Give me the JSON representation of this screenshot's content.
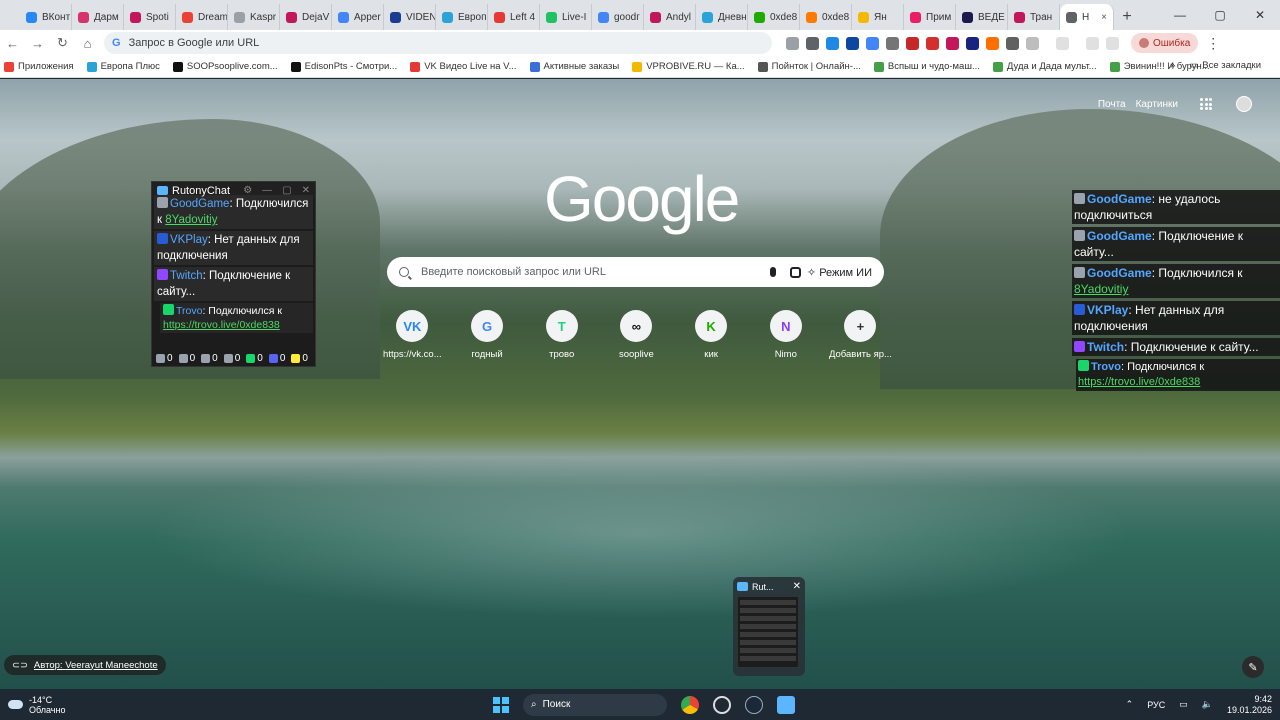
{
  "tabs": [
    {
      "label": "ВКонт",
      "color": "#2787f5"
    },
    {
      "label": "Дарм",
      "color": "#d6336c"
    },
    {
      "label": "Spoti",
      "color": "#c2185b"
    },
    {
      "label": "Dream",
      "color": "#ea4335"
    },
    {
      "label": "Kaspr",
      "color": "#9aa0a6"
    },
    {
      "label": "DejaV",
      "color": "#c2185b"
    },
    {
      "label": "Apper",
      "color": "#4285f4"
    },
    {
      "label": "VIDEN",
      "color": "#1a3d8f"
    },
    {
      "label": "Европ",
      "color": "#2aa3d8"
    },
    {
      "label": "Left 4",
      "color": "#e53935"
    },
    {
      "label": "Live-I",
      "color": "#21c063"
    },
    {
      "label": "goodг",
      "color": "#4285f4"
    },
    {
      "label": "Andyl",
      "color": "#c2185b"
    },
    {
      "label": "Дневн",
      "color": "#2aa3d8"
    },
    {
      "label": "0xde8",
      "color": "#1faa00"
    },
    {
      "label": "0xde8",
      "color": "#ff7a00"
    },
    {
      "label": "Ян",
      "color": "#f5b800"
    },
    {
      "label": "Прим",
      "color": "#e91e63"
    },
    {
      "label": "ВЕДЕ",
      "color": "#1a1a4d"
    },
    {
      "label": "Тран",
      "color": "#c2185b"
    }
  ],
  "active_tab": {
    "label": "Н",
    "close": "×"
  },
  "new_tab": "+",
  "window_controls": {
    "min": "—",
    "max": "▢",
    "close": "✕"
  },
  "omnibox": {
    "placeholder": "Запрос в Google или URL"
  },
  "error_button": "Ошибка",
  "bookmarks": [
    {
      "label": "Приложения",
      "color": "#ea4335"
    },
    {
      "label": "Европа Плюс",
      "color": "#2aa3d8"
    },
    {
      "label": "SOOPsooplive.com...",
      "color": "#111"
    },
    {
      "label": "EdisonPts - Смотри...",
      "color": "#111"
    },
    {
      "label": "VK Видео Live на V...",
      "color": "#e53935"
    },
    {
      "label": "Активные заказы",
      "color": "#3b6fd8"
    },
    {
      "label": "VPROBIVE.RU — Ка...",
      "color": "#f5b800"
    },
    {
      "label": "Пойнток | Онлайн-...",
      "color": "#555"
    },
    {
      "label": "Вспыш и чудо-маш...",
      "color": "#43a047"
    },
    {
      "label": "Дуда и Дада мульт...",
      "color": "#43a047"
    },
    {
      "label": "Эвинин!!! И бурун...",
      "color": "#43a047"
    }
  ],
  "all_bookmarks": "Все закладки",
  "google": {
    "logo": "Google",
    "top_links": {
      "mail": "Почта",
      "images": "Картинки"
    },
    "search_placeholder": "Введите поисковый запрос или URL",
    "ai_mode": "Режим ИИ",
    "shortcuts": [
      {
        "label": "https://vk.co...",
        "glyph": "VK",
        "color": "#2787f5"
      },
      {
        "label": "годный",
        "glyph": "G",
        "color": "#4285f4"
      },
      {
        "label": "трово",
        "glyph": "T",
        "color": "#1fd47c"
      },
      {
        "label": "sooplive",
        "glyph": "∞",
        "color": "#111"
      },
      {
        "label": "кик",
        "glyph": "K",
        "color": "#1faa00"
      },
      {
        "label": "Nimo",
        "glyph": "N",
        "color": "#8b3dff"
      },
      {
        "label": "Добавить яр...",
        "glyph": "+",
        "color": "#333"
      }
    ],
    "author_prefix": "Автор:",
    "author": "Veerayut Maneechote"
  },
  "rutony": {
    "title": "RutonyChat",
    "messages": [
      {
        "platform": "GoodGame",
        "text": ": Подключился к ",
        "link": "8Yadovitiy"
      },
      {
        "platform": "VKPlay",
        "text": ": Нет данных для подключения",
        "link": ""
      },
      {
        "platform": "Twitch",
        "text": ": Подключение к сайту...",
        "link": ""
      },
      {
        "platform": "Trovo",
        "text": ": Подключился к ",
        "link": "https://trovo.live/0xde838"
      }
    ],
    "stats": [
      "0",
      "0",
      "0",
      "0",
      "0",
      "0",
      "0"
    ]
  },
  "overlay": [
    {
      "platform": "GoodGame",
      "text": ": не удалось подключиться",
      "link": ""
    },
    {
      "platform": "GoodGame",
      "text": ": Подключение к сайту...",
      "link": ""
    },
    {
      "platform": "GoodGame",
      "text": ": Подключился к ",
      "link": "8Yadovitiy"
    },
    {
      "platform": "VKPlay",
      "text": ": Нет данных для подключения",
      "link": ""
    },
    {
      "platform": "Twitch",
      "text": ": Подключение к сайту...",
      "link": ""
    },
    {
      "platform": "Trovo",
      "text": ": Подключился к ",
      "link": "https://trovo.live/0xde838"
    }
  ],
  "thumbnail": {
    "title": "Rut...",
    "close": "✕"
  },
  "taskbar": {
    "temp": "-14°C",
    "weather": "Облачно",
    "search": "Поиск",
    "lang": "РУС",
    "time": "9:42",
    "date": "19.01.2026"
  }
}
